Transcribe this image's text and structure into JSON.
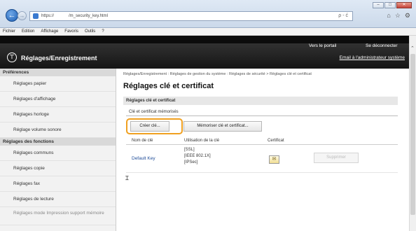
{
  "browser": {
    "url": "https://       /m_security_key.html",
    "address_tools": "ρ - ć",
    "window_buttons": [
      "–",
      "□",
      "✕"
    ],
    "chrome_icons": [
      "⌂",
      "☆",
      "⚙"
    ],
    "menu": [
      "Fichier",
      "Edition",
      "Affichage",
      "Favoris",
      "Outils",
      "?"
    ]
  },
  "header": {
    "dim_text": "          ",
    "logo_symbol": "⊤",
    "title": "Réglages/Enregistrement",
    "portal_link": "Vers le portail",
    "logout_link": "Se déconnecter",
    "admin_mail_link": "Email à l'administrateur système"
  },
  "sidebar": {
    "preferences_heading": "Préférences",
    "preferences_items": [
      "Réglages papier",
      "Réglages d'affichage",
      "Réglages horloge",
      "Réglage volume sonore"
    ],
    "functions_heading": "Réglages des fonctions",
    "functions_items": [
      "Réglages communs",
      "Réglages copie",
      "Réglages fax",
      "Réglages de lecture"
    ],
    "last_item": "Réglages mode Impression support mémoire"
  },
  "main": {
    "breadcrumb": "Réglages/Enregistrement : Réglages de gestion du système : Réglages de sécurité > Réglages clé et certificat",
    "title": "Réglages clé et certificat",
    "section": "Réglages clé et certificat",
    "subsection": "Clé et certificat mémorisés",
    "create_button": "Créer clé...",
    "memorize_button": "Mémoriser clé et certificat...",
    "columns": [
      "Nom de clé",
      "Utilisation de la clé",
      "Certificat"
    ],
    "rows": [
      {
        "key_name": "Default Key",
        "usage": [
          "[SSL]",
          "[IEEE 802.1X]",
          "[IPSec]"
        ],
        "certificate_icon": "certificate-icon"
      }
    ],
    "delete_button": "Supprimer",
    "cursor_symbol": "⌶"
  },
  "colors": {
    "highlight": "#f0a020",
    "link": "#1f4c98",
    "header_bg": "#1a1a1a"
  }
}
